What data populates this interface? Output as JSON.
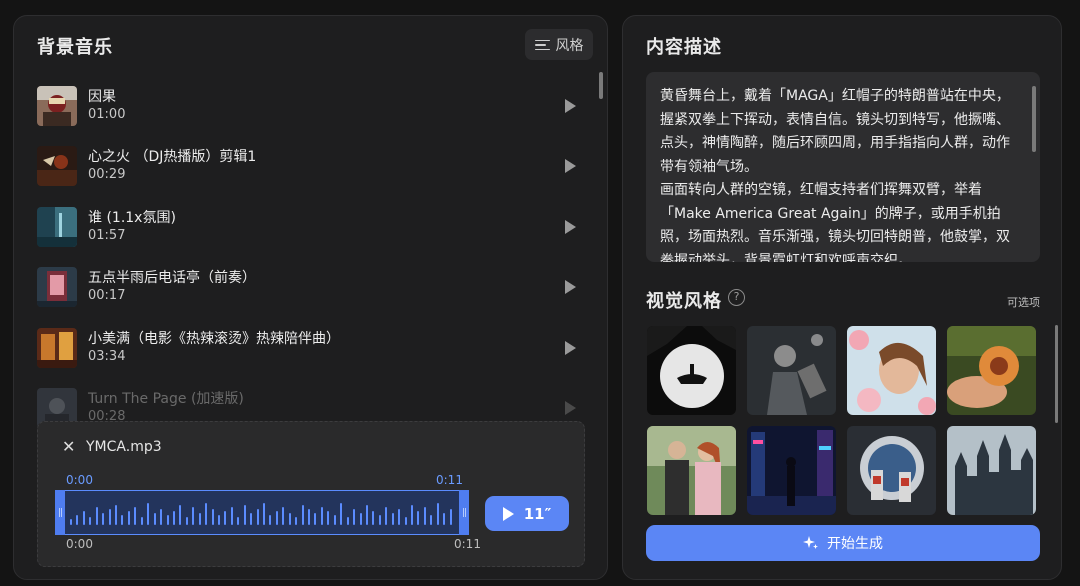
{
  "music_panel": {
    "title": "背景音乐",
    "style_button_label": "风格",
    "tracks": [
      {
        "name": "因果",
        "duration": "01:00"
      },
      {
        "name": "心之火 （DJ热播版）剪辑1",
        "duration": "00:29"
      },
      {
        "name": "谁 (1.1x氛围)",
        "duration": "01:57"
      },
      {
        "name": "五点半雨后电话亭（前奏）",
        "duration": "00:17"
      },
      {
        "name": "小美满（电影《热辣滚烫》热辣陪伴曲）",
        "duration": "03:34"
      },
      {
        "name": "Turn The Page (加速版)",
        "duration": "00:28"
      }
    ]
  },
  "audio_editor": {
    "close_symbol": "✕",
    "file_name": "YMCA.mp3",
    "selection_start": "0:00",
    "selection_end": "0:11",
    "timeline_start": "0:00",
    "timeline_end": "0:11",
    "play_label": "11″"
  },
  "description_panel": {
    "title": "内容描述",
    "text": "黄昏舞台上，戴着「MAGA」红帽子的特朗普站在中央，握紧双拳上下挥动，表情自信。镜头切到特写，他撅嘴、点头，神情陶醉，随后环顾四周，用手指指向人群，动作带有领袖气场。\n画面转向人群的空镜，红帽支持者们挥舞双臂，举着「Make America Great Again」的牌子，或用手机拍照，场面热烈。音乐渐强，镜头切回特朗普，他鼓掌，双拳握动举头，背景霓虹灯和欢呼声交织。"
  },
  "visual_style": {
    "title": "视觉风格",
    "help_symbol": "?",
    "optional_label": "可选项",
    "styles": [
      {
        "icon": "moon-silhouette-thumbnail"
      },
      {
        "icon": "concert-singer-thumbnail"
      },
      {
        "icon": "woman-blossoms-thumbnail"
      },
      {
        "icon": "peach-hand-thumbnail"
      },
      {
        "icon": "couple-portrait-thumbnail"
      },
      {
        "icon": "cyberpunk-city-thumbnail"
      },
      {
        "icon": "astronauts-portal-thumbnail"
      },
      {
        "icon": "gothic-castle-thumbnail"
      }
    ]
  },
  "generate_button_label": "开始生成",
  "colors": {
    "accent": "#5b86f5",
    "waveform": "#5b8cff",
    "panel_bg": "#1e1e1f"
  }
}
